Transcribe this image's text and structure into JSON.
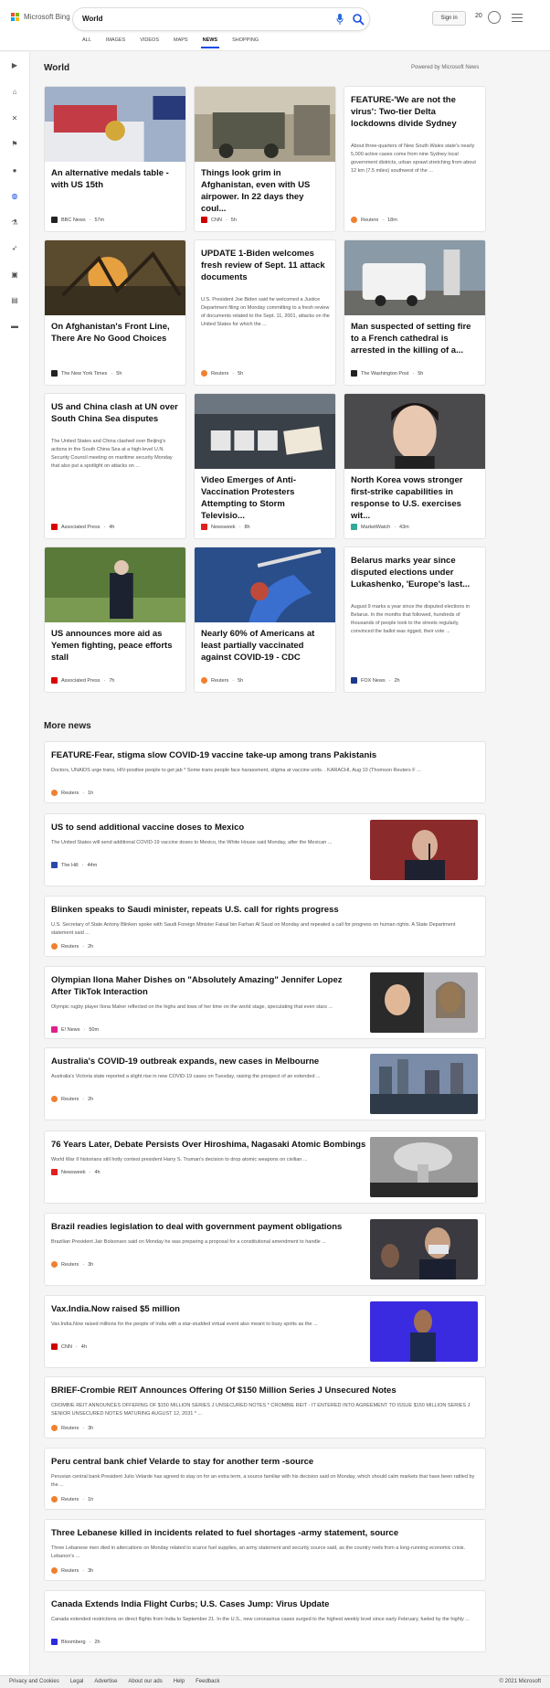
{
  "header": {
    "logo_text": "Microsoft Bing",
    "search_value": "World",
    "signin_label": "Sign in",
    "points": "20"
  },
  "tabs": [
    {
      "label": "ALL"
    },
    {
      "label": "IMAGES"
    },
    {
      "label": "VIDEOS"
    },
    {
      "label": "MAPS"
    },
    {
      "label": "NEWS",
      "active": true
    },
    {
      "label": "SHOPPING"
    }
  ],
  "section": {
    "title": "World",
    "powered": "Powered by Microsoft News"
  },
  "cards": [
    {
      "title": "An alternative medals table - with US 15th",
      "source": "BBC News",
      "time": "57m",
      "icon_color": "#222"
    },
    {
      "title": "Things look grim in Afghanistan, even with US airpower. In 22 days they coul...",
      "source": "CNN",
      "time": "5h",
      "icon_color": "#c00"
    },
    {
      "title": "FEATURE-'We are not the virus': Two-tier Delta lockdowns divide Sydney",
      "snippet": "About three-quarters of New South Wales state's nearly 5,000 active cases come from nine Sydney local government districts, urban sprawl stretching from about 12 km (7.5 miles) southwest of the ...",
      "source": "Reuters",
      "time": "18m",
      "icon_color": "#f08030"
    },
    {
      "title": "On Afghanistan's Front Line, There Are No Good Choices",
      "source": "The New York Times",
      "time": "5h",
      "icon_color": "#222"
    },
    {
      "title": "UPDATE 1-Biden welcomes fresh review of Sept. 11 attack documents",
      "snippet": "U.S. President Joe Biden said he welcomed a Justice Department filing on Monday committing to a fresh review of documents related to the Sept. 11, 2001, attacks on the United States for which the ...",
      "source": "Reuters",
      "time": "5h",
      "icon_color": "#f08030"
    },
    {
      "title": "Man suspected of setting fire to a French cathedral is arrested in the killing of a...",
      "source": "The Washington Post",
      "time": "5h",
      "icon_color": "#222"
    },
    {
      "title": "US and China clash at UN over South China Sea disputes",
      "snippet": "The United States and China clashed over Beijing's actions in the South China Sea at a high-level U.N. Security Council meeting on maritime security Monday that also put a spotlight on attacks on ...",
      "source": "Associated Press",
      "time": "4h",
      "icon_color": "#d00"
    },
    {
      "title": "Video Emerges of Anti-Vaccination Protesters Attempting to Storm Televisio...",
      "source": "Newsweek",
      "time": "8h",
      "icon_color": "#e02020"
    },
    {
      "title": "North Korea vows stronger first-strike capabilities in response to U.S. exercises wit...",
      "source": "MarketWatch",
      "time": "43m",
      "icon_color": "#3a9"
    },
    {
      "title": "US announces more aid as Yemen fighting, peace efforts stall",
      "source": "Associated Press",
      "time": "7h",
      "icon_color": "#d00"
    },
    {
      "title": "Nearly 60% of Americans at least partially vaccinated against COVID-19 - CDC",
      "source": "Reuters",
      "time": "5h",
      "icon_color": "#f08030"
    },
    {
      "title": "Belarus marks year since disputed elections under Lukashenko, 'Europe's last...",
      "snippet": "August 9 marks a year since the disputed elections in Belarus. In the months that followed, hundreds of thousands of people took to the streets regularly, convinced the ballot was rigged, their vote ...",
      "source": "FOX News",
      "time": "2h",
      "icon_color": "#1a3a8a"
    }
  ],
  "more_news": {
    "title": "More news",
    "items": [
      {
        "title": "FEATURE-Fear, stigma slow COVID-19 vaccine take-up among trans Pakistanis",
        "snippet": "Doctors, UNAIDS urge trans, HIV-positive people to get jab * Some trans people face harassment, stigma at vaccine units. . KARACHI, Aug 10 (Thomson Reuters F ...",
        "source": "Reuters",
        "time": "1h",
        "icon_color": "#f08030"
      },
      {
        "title": "US to send additional vaccine doses to Mexico",
        "snippet": "The United States will send additional COVID-19 vaccine doses to Mexico, the White House said Monday, after the Mexican ...",
        "source": "The Hill",
        "time": "44m",
        "icon_color": "#2a4aa8"
      },
      {
        "title": "Blinken speaks to Saudi minister, repeats U.S. call for rights progress",
        "snippet": "U.S. Secretary of State Antony Blinken spoke with Saudi Foreign Minister Faisal bin Farhan Al Saud on Monday and repeated a call for progress on human rights. A State Department statement said ...",
        "source": "Reuters",
        "time": "2h",
        "icon_color": "#f08030"
      },
      {
        "title": "Olympian Ilona Maher Dishes on \"Absolutely Amazing\" Jennifer Lopez After TikTok Interaction",
        "snippet": "Olympic rugby player Ilona Maher reflected on the highs and lows of her time on the world stage, speculating that even stars ...",
        "source": "E! News",
        "time": "50m",
        "icon_color": "#e0208a"
      },
      {
        "title": "Australia's COVID-19 outbreak expands, new cases in Melbourne",
        "snippet": "Australia's Victoria state reported a slight rise in new COVID-19 cases on Tuesday, raising the prospect of an extended ...",
        "source": "Reuters",
        "time": "2h",
        "icon_color": "#f08030"
      },
      {
        "title": "76 Years Later, Debate Persists Over Hiroshima, Nagasaki Atomic Bombings",
        "snippet": "World War II historians still hotly contest president Harry S. Truman's decision to drop atomic weapons on civilian ...",
        "source": "Newsweek",
        "time": "4h",
        "icon_color": "#e02020"
      },
      {
        "title": "Brazil readies legislation to deal with government payment obligations",
        "snippet": "Brazilian President Jair Bolsonaro said on Monday he was preparing a proposal for a constitutional amendment to handle ...",
        "source": "Reuters",
        "time": "3h",
        "icon_color": "#f08030"
      },
      {
        "title": "Vax.India.Now raised $5 million",
        "snippet": "Vax.India.Now raised millions for the people of India with a star-studded virtual event also meant to busy spirits as the ...",
        "source": "CNN",
        "time": "4h",
        "icon_color": "#c00"
      },
      {
        "title": "BRIEF-Crombie REIT Announces Offering Of $150 Million Series J Unsecured Notes",
        "snippet": "CROMBIE REIT ANNOUNCES OFFERING OF $150 MILLION SERIES J UNSECURED NOTES * CROMBIE REIT - IT ENTERED INTO AGREEMENT TO ISSUE $150 MILLION SERIES J SENIOR UNSECURED NOTES MATURING AUGUST 12, 2031 * ...",
        "source": "Reuters",
        "time": "3h",
        "icon_color": "#f08030"
      },
      {
        "title": "Peru central bank chief Velarde to stay for another term -source",
        "snippet": "Peruvian central bank President Julio Velarde has agreed to stay on for an extra term, a source familiar with his decision said on Monday, which should calm markets that have been rattled by the ...",
        "source": "Reuters",
        "time": "1h",
        "icon_color": "#f08030"
      },
      {
        "title": "Three Lebanese killed in incidents related to fuel shortages -army statement, source",
        "snippet": "Three Lebanese men died in altercations on Monday related to scarce fuel supplies, an army statement and security source said, as the country reels from a long-running economic crisis. Lebanon's ...",
        "source": "Reuters",
        "time": "3h",
        "icon_color": "#f08030"
      },
      {
        "title": "Canada Extends India Flight Curbs; U.S. Cases Jump: Virus Update",
        "snippet": "Canada extended restrictions on direct flights from India to September 21. In the U.S., new coronavirus cases surged to the highest weekly level since early February, fueled by the highly ...",
        "source": "Bloomberg",
        "time": "2h",
        "icon_color": "#2a2ae0"
      }
    ]
  },
  "footer": {
    "links": [
      "Privacy and Cookies",
      "Legal",
      "Advertise",
      "About our ads",
      "Help",
      "Feedback"
    ],
    "copyright": "© 2021 Microsoft"
  }
}
